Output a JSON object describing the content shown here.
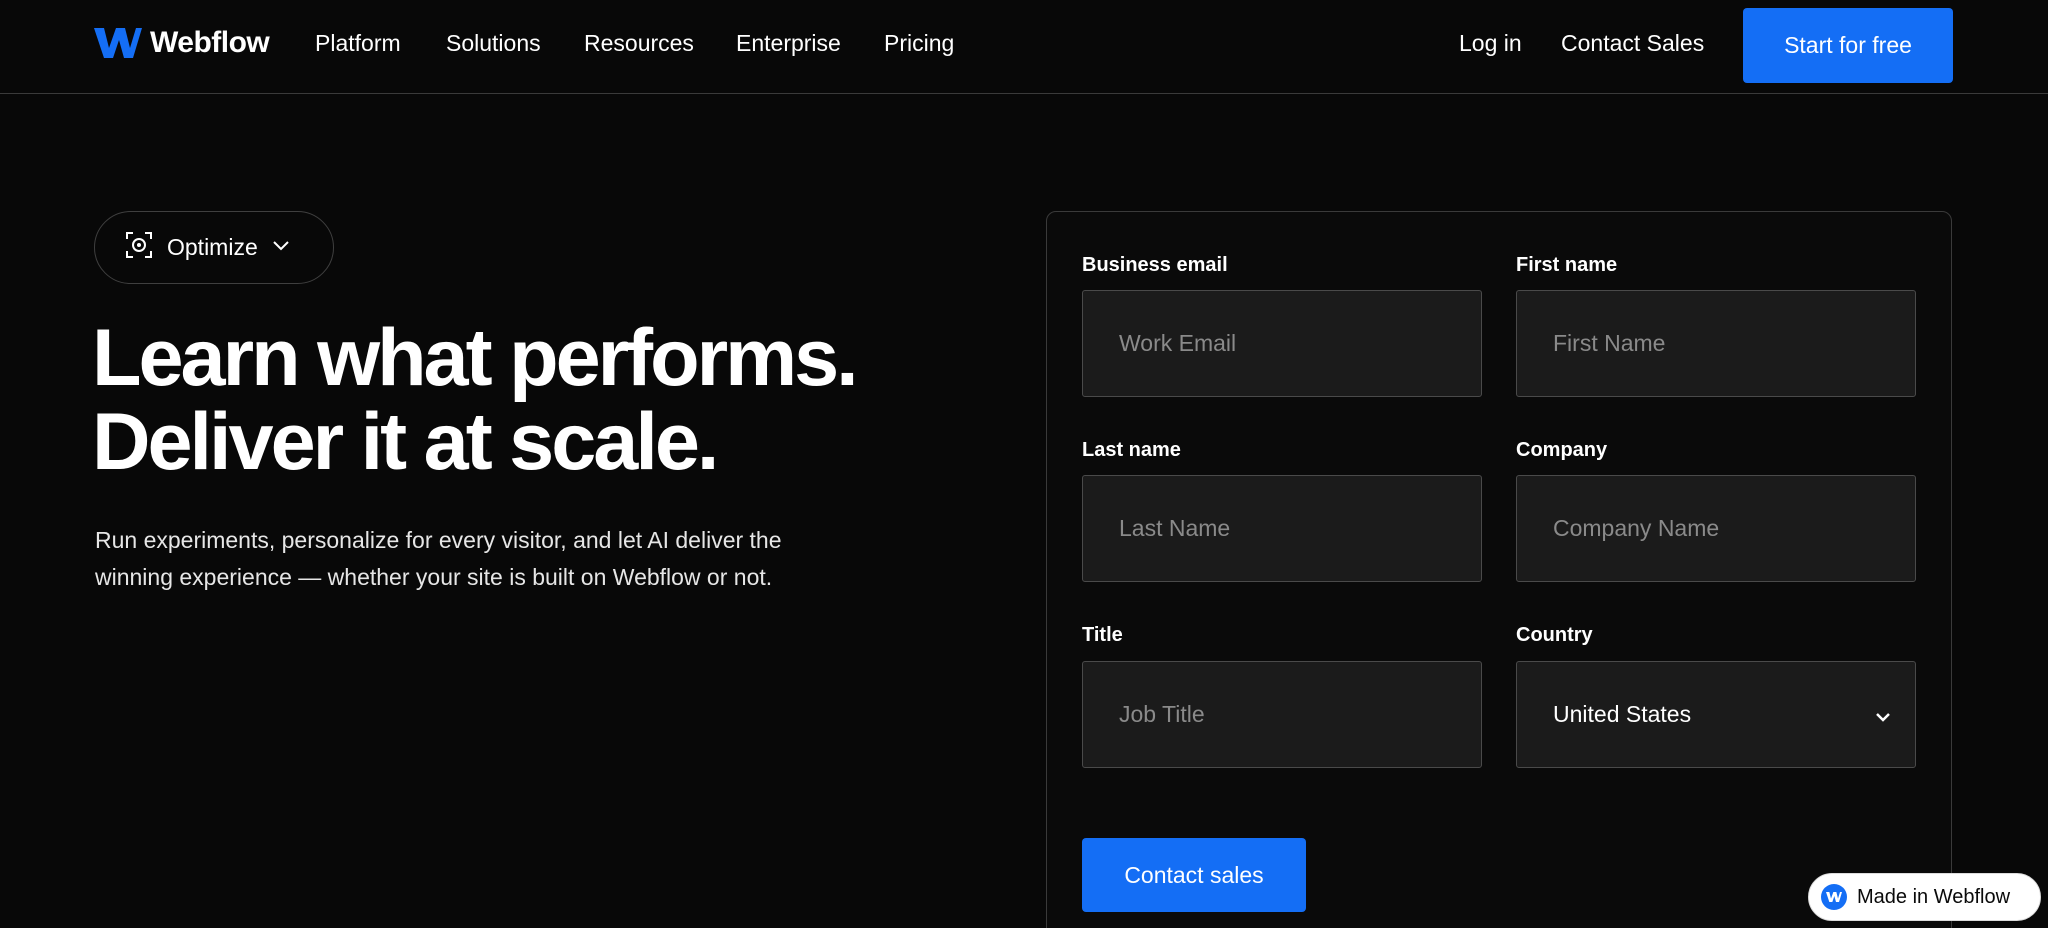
{
  "brand": {
    "name": "Webflow",
    "accent": "#146ef5"
  },
  "nav": {
    "links": [
      "Platform",
      "Solutions",
      "Resources",
      "Enterprise",
      "Pricing"
    ],
    "login": "Log in",
    "contact": "Contact Sales",
    "cta": "Start for free"
  },
  "hero": {
    "pill_label": "Optimize",
    "pill_icon": "scan-eye-icon",
    "headline_line1": "Learn what performs.",
    "headline_line2": "Deliver it at scale.",
    "subtext_line1": "Run experiments, personalize for every visitor, and let AI deliver the",
    "subtext_line2": "winning experience — whether your site is built on Webflow or not."
  },
  "form": {
    "email": {
      "label": "Business email",
      "placeholder": "Work Email"
    },
    "first_name": {
      "label": "First name",
      "placeholder": "First Name"
    },
    "last_name": {
      "label": "Last name",
      "placeholder": "Last Name"
    },
    "company": {
      "label": "Company",
      "placeholder": "Company Name"
    },
    "title": {
      "label": "Title",
      "placeholder": "Job Title"
    },
    "country": {
      "label": "Country",
      "value": "United States"
    },
    "submit": "Contact sales"
  },
  "badge": {
    "label": "Made in Webflow"
  }
}
